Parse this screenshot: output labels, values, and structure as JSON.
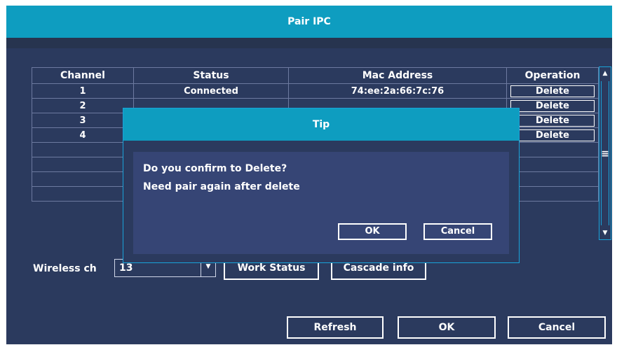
{
  "window": {
    "title": "Pair IPC"
  },
  "table": {
    "headers": [
      "Channel",
      "Status",
      "Mac Address",
      "Operation"
    ],
    "rows": [
      {
        "channel": "1",
        "status": "Connected",
        "mac": "74:ee:2a:66:7c:76",
        "operation": "Delete"
      },
      {
        "channel": "2",
        "status": "",
        "mac": "",
        "operation": "Delete"
      },
      {
        "channel": "3",
        "status": "",
        "mac": "",
        "operation": "Delete"
      },
      {
        "channel": "4",
        "status": "",
        "mac": "",
        "operation": "Delete"
      }
    ]
  },
  "scrollbar": {
    "up_icon": "arrow-up-icon",
    "down_icon": "arrow-down-icon",
    "thumb_icon": "grip-icon"
  },
  "wireless": {
    "label": "Wireless ch",
    "value": "13"
  },
  "buttons": {
    "work_status": "Work Status",
    "cascade_info": "Cascade info",
    "refresh": "Refresh",
    "ok": "OK",
    "cancel": "Cancel"
  },
  "dialog": {
    "title": "Tip",
    "line1": "Do you confirm to Delete?",
    "line2": "Need pair again after delete",
    "ok": "OK",
    "cancel": "Cancel"
  },
  "colors": {
    "title_bar": "#0e9dc0",
    "panel": "#2b3a5e",
    "dialog_body": "#364575",
    "border_accent": "#19a3d9"
  }
}
